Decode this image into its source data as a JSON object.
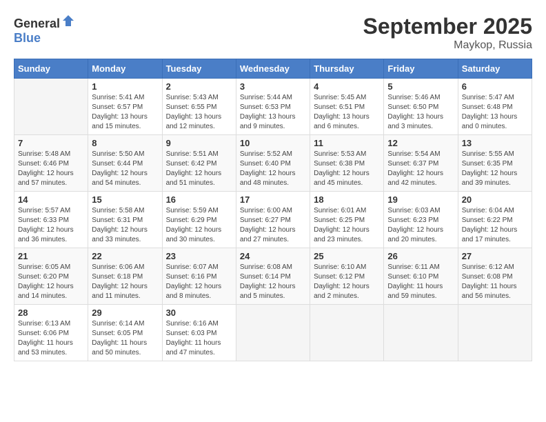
{
  "header": {
    "logo_general": "General",
    "logo_blue": "Blue",
    "month": "September 2025",
    "location": "Maykop, Russia"
  },
  "days_of_week": [
    "Sunday",
    "Monday",
    "Tuesday",
    "Wednesday",
    "Thursday",
    "Friday",
    "Saturday"
  ],
  "weeks": [
    [
      {
        "day": "",
        "info": ""
      },
      {
        "day": "1",
        "info": "Sunrise: 5:41 AM\nSunset: 6:57 PM\nDaylight: 13 hours\nand 15 minutes."
      },
      {
        "day": "2",
        "info": "Sunrise: 5:43 AM\nSunset: 6:55 PM\nDaylight: 13 hours\nand 12 minutes."
      },
      {
        "day": "3",
        "info": "Sunrise: 5:44 AM\nSunset: 6:53 PM\nDaylight: 13 hours\nand 9 minutes."
      },
      {
        "day": "4",
        "info": "Sunrise: 5:45 AM\nSunset: 6:51 PM\nDaylight: 13 hours\nand 6 minutes."
      },
      {
        "day": "5",
        "info": "Sunrise: 5:46 AM\nSunset: 6:50 PM\nDaylight: 13 hours\nand 3 minutes."
      },
      {
        "day": "6",
        "info": "Sunrise: 5:47 AM\nSunset: 6:48 PM\nDaylight: 13 hours\nand 0 minutes."
      }
    ],
    [
      {
        "day": "7",
        "info": "Sunrise: 5:48 AM\nSunset: 6:46 PM\nDaylight: 12 hours\nand 57 minutes."
      },
      {
        "day": "8",
        "info": "Sunrise: 5:50 AM\nSunset: 6:44 PM\nDaylight: 12 hours\nand 54 minutes."
      },
      {
        "day": "9",
        "info": "Sunrise: 5:51 AM\nSunset: 6:42 PM\nDaylight: 12 hours\nand 51 minutes."
      },
      {
        "day": "10",
        "info": "Sunrise: 5:52 AM\nSunset: 6:40 PM\nDaylight: 12 hours\nand 48 minutes."
      },
      {
        "day": "11",
        "info": "Sunrise: 5:53 AM\nSunset: 6:38 PM\nDaylight: 12 hours\nand 45 minutes."
      },
      {
        "day": "12",
        "info": "Sunrise: 5:54 AM\nSunset: 6:37 PM\nDaylight: 12 hours\nand 42 minutes."
      },
      {
        "day": "13",
        "info": "Sunrise: 5:55 AM\nSunset: 6:35 PM\nDaylight: 12 hours\nand 39 minutes."
      }
    ],
    [
      {
        "day": "14",
        "info": "Sunrise: 5:57 AM\nSunset: 6:33 PM\nDaylight: 12 hours\nand 36 minutes."
      },
      {
        "day": "15",
        "info": "Sunrise: 5:58 AM\nSunset: 6:31 PM\nDaylight: 12 hours\nand 33 minutes."
      },
      {
        "day": "16",
        "info": "Sunrise: 5:59 AM\nSunset: 6:29 PM\nDaylight: 12 hours\nand 30 minutes."
      },
      {
        "day": "17",
        "info": "Sunrise: 6:00 AM\nSunset: 6:27 PM\nDaylight: 12 hours\nand 27 minutes."
      },
      {
        "day": "18",
        "info": "Sunrise: 6:01 AM\nSunset: 6:25 PM\nDaylight: 12 hours\nand 23 minutes."
      },
      {
        "day": "19",
        "info": "Sunrise: 6:03 AM\nSunset: 6:23 PM\nDaylight: 12 hours\nand 20 minutes."
      },
      {
        "day": "20",
        "info": "Sunrise: 6:04 AM\nSunset: 6:22 PM\nDaylight: 12 hours\nand 17 minutes."
      }
    ],
    [
      {
        "day": "21",
        "info": "Sunrise: 6:05 AM\nSunset: 6:20 PM\nDaylight: 12 hours\nand 14 minutes."
      },
      {
        "day": "22",
        "info": "Sunrise: 6:06 AM\nSunset: 6:18 PM\nDaylight: 12 hours\nand 11 minutes."
      },
      {
        "day": "23",
        "info": "Sunrise: 6:07 AM\nSunset: 6:16 PM\nDaylight: 12 hours\nand 8 minutes."
      },
      {
        "day": "24",
        "info": "Sunrise: 6:08 AM\nSunset: 6:14 PM\nDaylight: 12 hours\nand 5 minutes."
      },
      {
        "day": "25",
        "info": "Sunrise: 6:10 AM\nSunset: 6:12 PM\nDaylight: 12 hours\nand 2 minutes."
      },
      {
        "day": "26",
        "info": "Sunrise: 6:11 AM\nSunset: 6:10 PM\nDaylight: 11 hours\nand 59 minutes."
      },
      {
        "day": "27",
        "info": "Sunrise: 6:12 AM\nSunset: 6:08 PM\nDaylight: 11 hours\nand 56 minutes."
      }
    ],
    [
      {
        "day": "28",
        "info": "Sunrise: 6:13 AM\nSunset: 6:06 PM\nDaylight: 11 hours\nand 53 minutes."
      },
      {
        "day": "29",
        "info": "Sunrise: 6:14 AM\nSunset: 6:05 PM\nDaylight: 11 hours\nand 50 minutes."
      },
      {
        "day": "30",
        "info": "Sunrise: 6:16 AM\nSunset: 6:03 PM\nDaylight: 11 hours\nand 47 minutes."
      },
      {
        "day": "",
        "info": ""
      },
      {
        "day": "",
        "info": ""
      },
      {
        "day": "",
        "info": ""
      },
      {
        "day": "",
        "info": ""
      }
    ]
  ]
}
